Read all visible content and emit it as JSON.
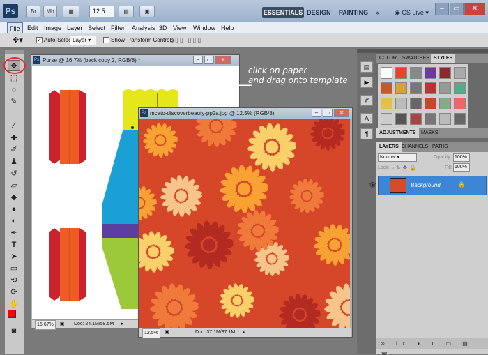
{
  "titlebar": {
    "logo": "Ps",
    "btn_br": "Br",
    "btn_mb": "Mb",
    "zoom": "12.5",
    "workspaces": [
      "ESSENTIALS",
      "DESIGN",
      "PAINTING"
    ],
    "more": "»",
    "cslive": "CS Live"
  },
  "menu": [
    "File",
    "Edit",
    "Image",
    "Layer",
    "Select",
    "Filter",
    "Analysis",
    "3D",
    "View",
    "Window",
    "Help"
  ],
  "options": {
    "auto_select_label": "Auto-Select:",
    "auto_select_value": "Layer",
    "show_transform_label": "Show Transform Controls"
  },
  "doc1": {
    "title": "Purse @ 16.7% (back copy 2, RGB/8) *",
    "zoom": "16.67%",
    "doc_size": "Doc: 24.1M/58.5M"
  },
  "doc2": {
    "title": "mcato-discoverbeauty-pp2a.jpg @ 12.5% (RGB/8)",
    "zoom": "12.5%",
    "doc_size": "Doc: 37.1M/37.1M"
  },
  "annotation": {
    "line1": "click on paper",
    "line2": "and drag onto template"
  },
  "panel": {
    "top_tabs": [
      "COLOR",
      "SWATCHES",
      "STYLES"
    ],
    "mid_tabs": [
      "ADJUSTMENTS",
      "MASKS"
    ],
    "layer_tabs": [
      "LAYERS",
      "CHANNELS",
      "PATHS"
    ],
    "blend_mode": "Normal",
    "opacity_label": "Opacity:",
    "opacity_value": "100%",
    "lock_label": "Lock:",
    "fill_label": "Fill:",
    "fill_value": "100%",
    "layer_name": "Background"
  },
  "colors": {
    "accent_circle": "#e62b2b",
    "layer_selected": "#3d86d6",
    "foreground": "#ff0000",
    "background": "#000000"
  }
}
